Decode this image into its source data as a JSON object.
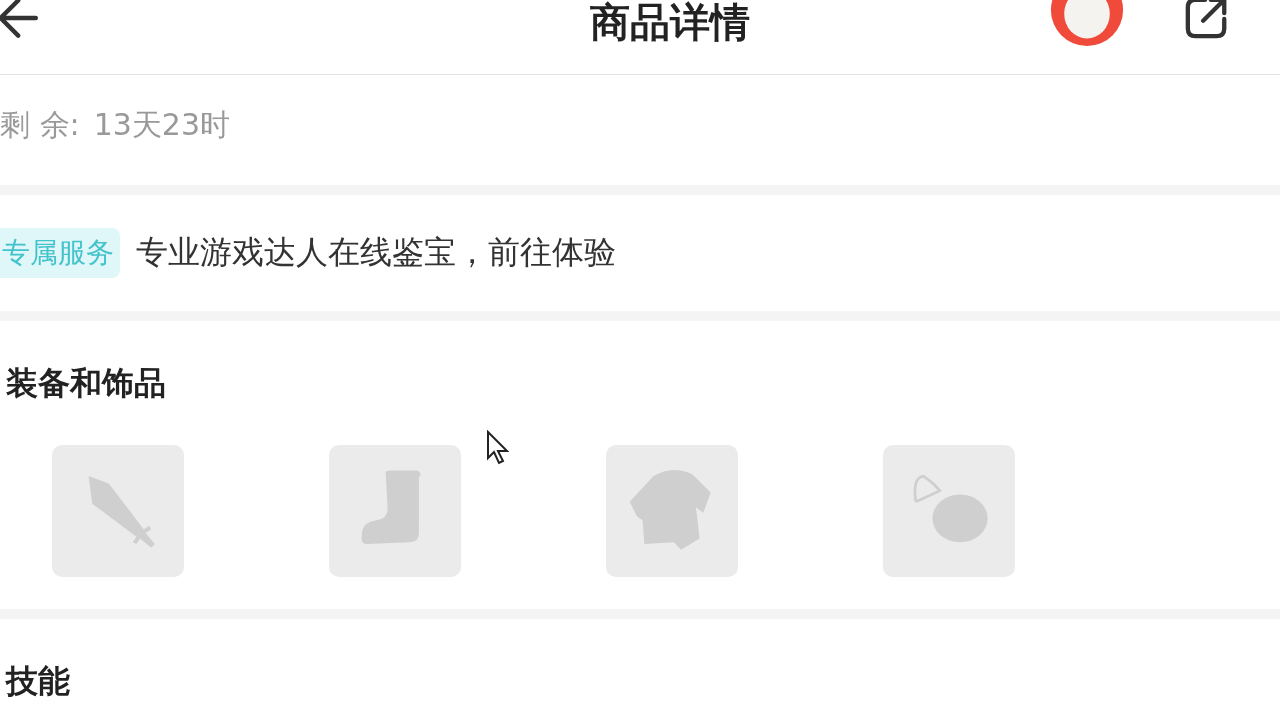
{
  "header": {
    "title": "商品详情"
  },
  "info_rows": [
    [
      {
        "label": "剩 余:",
        "value": "13天23时"
      }
    ]
  ],
  "service": {
    "tag": "专属服务",
    "text": "专业游戏达人在线鉴宝，前往体验"
  },
  "equipment": {
    "title": "装备和饰品",
    "slots": [
      {
        "kind": "weapon"
      },
      {
        "kind": "boots"
      },
      {
        "kind": "armor"
      },
      {
        "kind": "accessory"
      }
    ]
  },
  "skills": {
    "title": "技能"
  }
}
